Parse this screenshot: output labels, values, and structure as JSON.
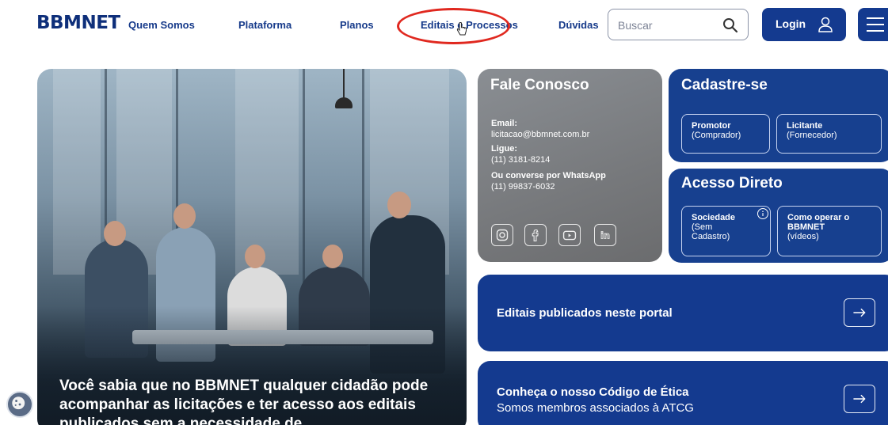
{
  "nav": {
    "logo": "BBMNET",
    "links": [
      "Quem Somos",
      "Plataforma",
      "Planos",
      "Editais e Processos",
      "Dúvidas"
    ],
    "search_placeholder": "Buscar",
    "login_label": "Login"
  },
  "hero": {
    "text": "Você sabia que no BBMNET qualquer cidadão pode acompanhar as licitações e ter acesso aos editais publicados sem a necessidade de"
  },
  "contact": {
    "title": "Fale Conosco",
    "email_label": "Email:",
    "email": "licitacao@bbmnet.com.br",
    "phone_label": "Ligue:",
    "phone": "(11) 3181-8214",
    "whatsapp_label": "Ou converse por WhatsApp",
    "whatsapp": "(11) 99837-6032",
    "social_icons": [
      "instagram-icon",
      "facebook-icon",
      "youtube-icon",
      "linkedin-icon"
    ]
  },
  "register": {
    "title": "Cadastre-se",
    "options": [
      {
        "title": "Promotor",
        "sub": "(Comprador)"
      },
      {
        "title": "Licitante",
        "sub": "(Fornecedor)"
      }
    ]
  },
  "direct_access": {
    "title": "Acesso Direto",
    "options": [
      {
        "title": "Sociedade",
        "sub1": "(Sem",
        "sub2": "Cadastro)"
      },
      {
        "title": "Como operar o",
        "title2": "BBMNET",
        "sub": "(vídeos)"
      }
    ]
  },
  "cards": [
    {
      "title": "Editais publicados neste portal"
    },
    {
      "title": "Conheça o nosso Código de Ética",
      "subtitle": "Somos membros associados à ATCG"
    }
  ],
  "colors": {
    "brand_blue": "#143a8f",
    "highlight_red": "#e0281f"
  }
}
